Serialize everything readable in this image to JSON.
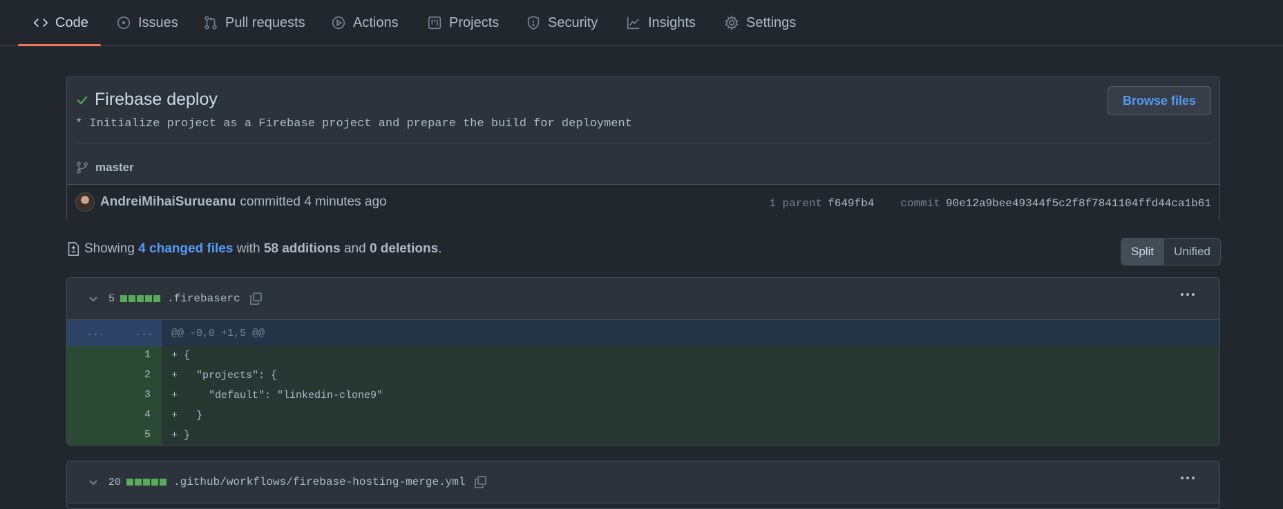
{
  "nav": {
    "tabs": [
      {
        "label": "Code",
        "icon": "code-icon"
      },
      {
        "label": "Issues",
        "icon": "issue-icon"
      },
      {
        "label": "Pull requests",
        "icon": "pull-request-icon"
      },
      {
        "label": "Actions",
        "icon": "play-icon"
      },
      {
        "label": "Projects",
        "icon": "project-icon"
      },
      {
        "label": "Security",
        "icon": "shield-icon"
      },
      {
        "label": "Insights",
        "icon": "graph-icon"
      },
      {
        "label": "Settings",
        "icon": "gear-icon"
      }
    ],
    "active": "Code",
    "accent": "#ec775c"
  },
  "commit": {
    "title": "Firebase deploy",
    "description": "* Initialize project as a Firebase project and prepare the build for deployment",
    "browse_label": "Browse files",
    "branch": "master",
    "author": "AndreiMihaiSurueanu",
    "action": "committed 4 minutes ago",
    "parent_label": "1 parent",
    "parent_sha": "f649fb4",
    "commit_label": "commit",
    "commit_sha": "90e12a9bee49344f5c2f8f7841104ffd44ca1b61",
    "status_color": "#57ab5a"
  },
  "summary": {
    "prefix": "Showing",
    "changed_files": "4 changed files",
    "with": "with",
    "additions": "58 additions",
    "and": "and",
    "deletions": "0 deletions",
    "suffix": "."
  },
  "view_toggle": {
    "split": "Split",
    "unified": "Unified",
    "selected": "Split"
  },
  "files": [
    {
      "count": "5",
      "name": ".firebaserc",
      "hunk_left": "...",
      "hunk_right": "...",
      "hunk": "@@ -0,0 +1,5 @@",
      "lines": [
        {
          "num": "1",
          "code": "+ {"
        },
        {
          "num": "2",
          "code": "+   \"projects\": {"
        },
        {
          "num": "3",
          "code": "+     \"default\": \"linkedin-clone9\""
        },
        {
          "num": "4",
          "code": "+   }"
        },
        {
          "num": "5",
          "code": "+ }"
        }
      ]
    },
    {
      "count": "20",
      "name": ".github/workflows/firebase-hosting-merge.yml"
    }
  ]
}
